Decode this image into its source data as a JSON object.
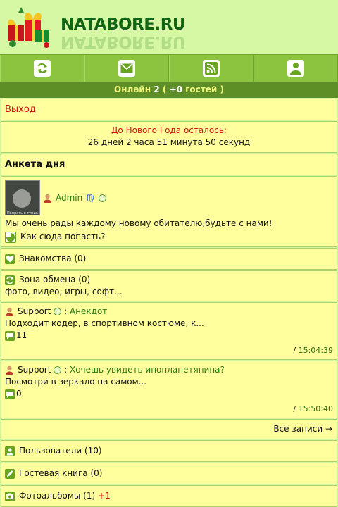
{
  "site": {
    "logo_text": "NATABORE.RU"
  },
  "nav": {
    "icons": [
      "refresh-icon",
      "mail-icon",
      "rss-icon",
      "user-icon"
    ],
    "colors": {
      "bar": "#8cc440",
      "online_bg": "#5e8f27"
    }
  },
  "online": {
    "label": "Онлайн",
    "count": "2",
    "open": "(",
    "guests": "+0",
    "guests_label": "гостей",
    "close": ")"
  },
  "exit": {
    "label": "Выход"
  },
  "newyear": {
    "title": "До Нового Года осталось:",
    "countdown": "26 дней 2 часа 51 минута 50 секунд"
  },
  "anketa": {
    "title": "Анкета дня",
    "photo_caption": "Попрать в тупик",
    "user": "Admin",
    "zodiac_symbol": "♍",
    "welcome": "Мы очень рады каждому новому обитателю,будьте с нами!",
    "how_to": "Как сюда попасть?"
  },
  "dating": {
    "label": "Знакомства (0)"
  },
  "exchange": {
    "label": "Зона обмена (0)",
    "desc": "фото, видео, игры, софт..."
  },
  "posts": [
    {
      "author": "Support",
      "sep": ":",
      "title": "Анекдот",
      "preview": "Подходит кодер, в спортивном костюме, к...",
      "comments": "11",
      "time_sep": "/",
      "time": "15:04:39"
    },
    {
      "author": "Support",
      "sep": ":",
      "title": "Хочешь увидеть инопланетянина?",
      "preview": "Посмотри в зеркало на самом...",
      "comments": "0",
      "time_sep": "/",
      "time": "15:50:40"
    }
  ],
  "all_records": {
    "label": "Все записи →"
  },
  "users": {
    "label": "Пользователи (10)"
  },
  "guestbook": {
    "label": "Гостевая книга (0)"
  },
  "albums": {
    "label": "Фотоальбомы (1)",
    "new": "+1"
  }
}
